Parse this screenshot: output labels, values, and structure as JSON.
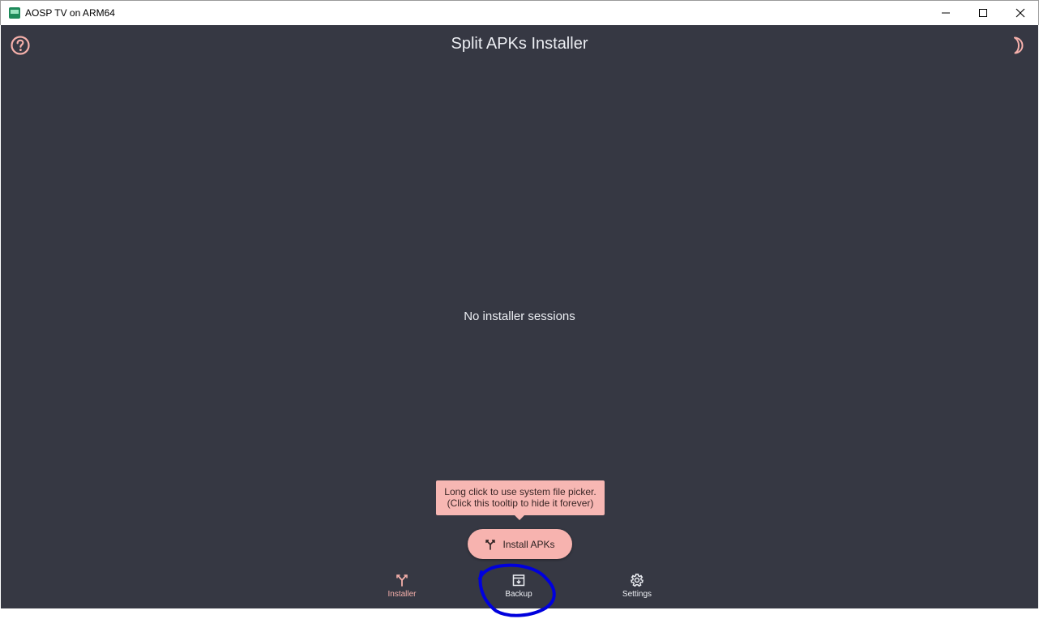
{
  "window": {
    "title": "AOSP TV on ARM64",
    "minimize_icon": "minimize-icon",
    "maximize_icon": "maximize-icon",
    "close_icon": "close-icon"
  },
  "app": {
    "title": "Split APKs Installer",
    "help_icon": "help-circle-icon",
    "theme_icon": "moon-icon",
    "empty_message": "No installer sessions",
    "background_color": "#363843",
    "accent_color": "#f7b3af"
  },
  "tooltip": {
    "line1": "Long click to use system file picker.",
    "line2": "(Click this tooltip to hide it forever)"
  },
  "fab": {
    "label": "Install APKs",
    "icon": "split-arrow-icon"
  },
  "bottom_nav": {
    "items": [
      {
        "label": "Installer",
        "icon": "split-arrow-icon",
        "selected": true
      },
      {
        "label": "Backup",
        "icon": "archive-icon",
        "selected": false
      },
      {
        "label": "Settings",
        "icon": "gear-icon",
        "selected": false
      }
    ]
  },
  "annotation": {
    "color": "#0000dd"
  }
}
